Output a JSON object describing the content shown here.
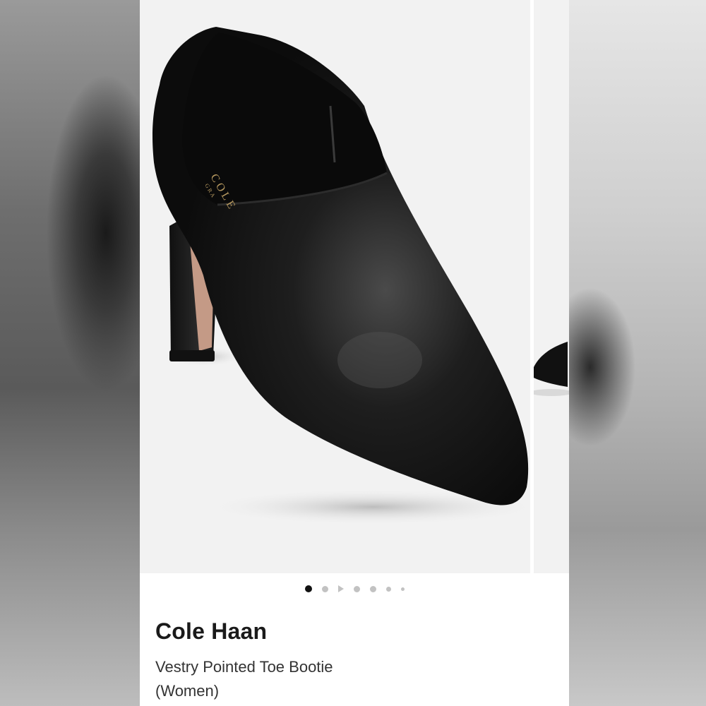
{
  "product": {
    "brand": "Cole Haan",
    "name_line1": "Vestry Pointed Toe Bootie",
    "name_line2": "(Women)",
    "insole_print_1": "COLE",
    "insole_print_2": "GRA"
  },
  "carousel": {
    "slide_count": 7,
    "active_index": 0,
    "items": [
      "image",
      "image",
      "video",
      "image",
      "image",
      "image",
      "image"
    ]
  },
  "icons": {
    "video_indicator": "play-icon"
  },
  "colors": {
    "background": "#ffffff",
    "image_background": "#f2f2f2",
    "dot_active": "#111111",
    "dot_inactive": "#c2c2c2",
    "text_primary": "#1a1a1a",
    "text_secondary": "#333333"
  }
}
